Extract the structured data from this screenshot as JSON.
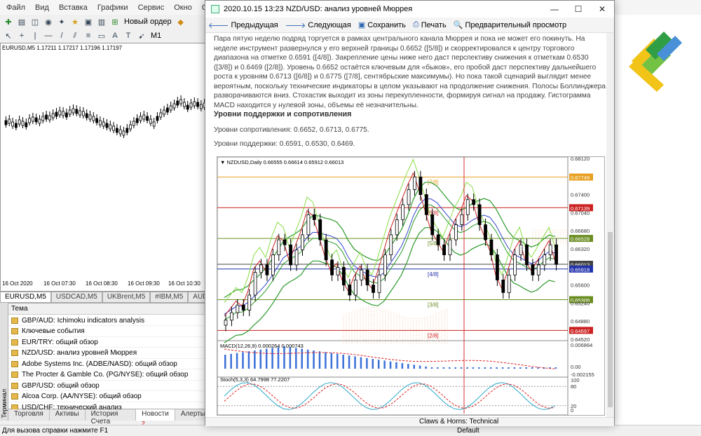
{
  "menubar": {
    "items": [
      "Файл",
      "Вид",
      "Вставка",
      "Графики",
      "Сервис",
      "Окно",
      "Справка"
    ]
  },
  "toolbar": {
    "new_order": "Новый ордер",
    "timeframe": "M1"
  },
  "bg_chart": {
    "symbol_label": "EURUSD,M5  1.17211 1.17217 1.17196 1.17197",
    "times": [
      "16 Oct 2020",
      "16 Oct 07:30",
      "16 Oct 08:30",
      "16 Oct 09:30",
      "16 Oct 10:30"
    ],
    "tabs": [
      "EURUSD,M5",
      "USDCAD,M5",
      "UKBrent,M5",
      "#IBM,M5",
      "AUDU"
    ],
    "active_tab": 0
  },
  "terminal": {
    "side_label": "Терминал",
    "header": "Тема",
    "news": [
      "GBP/AUD: Ichimoku indicators analysis",
      "Ключевые события",
      "EUR/TRY: общий обзор",
      "NZD/USD: анализ уровней Мюррея",
      "Adobe Systems Inc. (ADBE/NASD): общий обзор",
      "The Procter & Gamble Co. (PG/NYSE): общий обзор",
      "GBP/USD: общий обзор",
      "Alcoa Corp. (AA/NYSE): общий обзор",
      "USD/CHF: технический анализ"
    ],
    "tabs": [
      "Торговля",
      "Активы",
      "История Счета",
      "Новости",
      "Алерты"
    ],
    "news_badge": "2",
    "active_tab": 3
  },
  "statusbar": {
    "help": "Для вызова справки нажмите F1",
    "profile": "Default"
  },
  "window": {
    "title": "2020.10.15 13:23 NZD/USD: анализ уровней Мюррея",
    "minimize": "—",
    "maximize": "☐",
    "close": "✕",
    "toolbar": {
      "prev": "Предыдущая",
      "next": "Следующая",
      "save": "Сохранить",
      "print": "Печать",
      "preview": "Предварительный просмотр"
    },
    "paragraph": "Пара пятую неделю подряд торгуется в рамках центрального канала Мюррея и пока не может его покинуть. На неделе инструмент развернулся у его верхней границы 0.6652 ([5/8]) и скорректировался к центру торгового диапазона на отметке 0.6591 ([4/8]). Закрепление цены ниже него даст перспективу снижения к отметкам 0.6530 ([3/8]) и 0.6469 ([2/8]). Уровень 0.6652 остаётся ключевым для «быков», его пробой даст перспективу дальнейшего роста к уровням 0.6713 ([6/8]) и 0.6775 ([7/8], сентябрьские максимумы). Но пока такой сценарий выглядит менее вероятным, поскольку технические индикаторы в целом указывают на продолжение снижения. Полосы Боллинджера разворачиваются вниз. Стохастик выходит из зоны перекупленности, формируя сигнал на продажу. Гистограмма MACD находится у нулевой зоны, объемы её незначительны.",
    "heading": "Уровни поддержки и сопротивления",
    "resistance": "Уровни сопротивления: 0.6652, 0.6713, 0.6775.",
    "support": "Уровни поддержки: 0.6591, 0.6530, 0.6469.",
    "footer": "Claws & Horns: Technical"
  },
  "chart_data": {
    "type": "line",
    "title": "NZDUSD,Daily  0.66555 0.66614 0.65912 0.66013",
    "ylim": [
      0.6452,
      0.6812
    ],
    "yticks": [
      "0.68120",
      "0.67400",
      "0.67040",
      "0.66680",
      "0.66320",
      "0.65600",
      "0.65240",
      "0.64880",
      "0.64520"
    ],
    "murrey_levels": [
      {
        "label": "[7/8]",
        "price": "0.67749",
        "value": 0.67749,
        "color": "#e8a020"
      },
      {
        "label": "[6/8]",
        "price": "0.67139",
        "value": 0.67139,
        "color": "#cc2222"
      },
      {
        "label": "[5/8]",
        "price": "0.66528",
        "value": 0.66528,
        "color": "#6b8e23"
      },
      {
        "label": "",
        "price": "0.66013",
        "value": 0.66013,
        "color": "#444444"
      },
      {
        "label": "[4/8]",
        "price": "0.65918",
        "value": 0.65918,
        "color": "#2233aa"
      },
      {
        "label": "[3/8]",
        "price": "0.65308",
        "value": 0.65308,
        "color": "#6b8e23"
      },
      {
        "label": "[2/8]",
        "price": "0.64697",
        "value": 0.64697,
        "color": "#cc2222"
      }
    ],
    "candles": [
      0.649,
      0.6505,
      0.652,
      0.651,
      0.654,
      0.6585,
      0.66,
      0.658,
      0.662,
      0.665,
      0.664,
      0.66,
      0.663,
      0.666,
      0.67,
      0.669,
      0.665,
      0.661,
      0.658,
      0.6595,
      0.656,
      0.654,
      0.657,
      0.659,
      0.656,
      0.6545,
      0.658,
      0.662,
      0.666,
      0.669,
      0.672,
      0.675,
      0.6775,
      0.674,
      0.67,
      0.666,
      0.664,
      0.662,
      0.665,
      0.668,
      0.67,
      0.673,
      0.672,
      0.668,
      0.665,
      0.662,
      0.657,
      0.6545,
      0.658,
      0.662,
      0.664,
      0.66,
      0.658,
      0.66,
      0.662,
      0.664,
      0.6601
    ],
    "macd_label": "MACD(12,26,9) 0.000264 0.000743",
    "macd_ticks": [
      "0.006864",
      "0.00",
      "-0.002155"
    ],
    "stoch_label": "Stoch(5,3,3) 64.7998 77.2207",
    "stoch_ticks": [
      "100",
      "80",
      "20",
      "0"
    ]
  }
}
